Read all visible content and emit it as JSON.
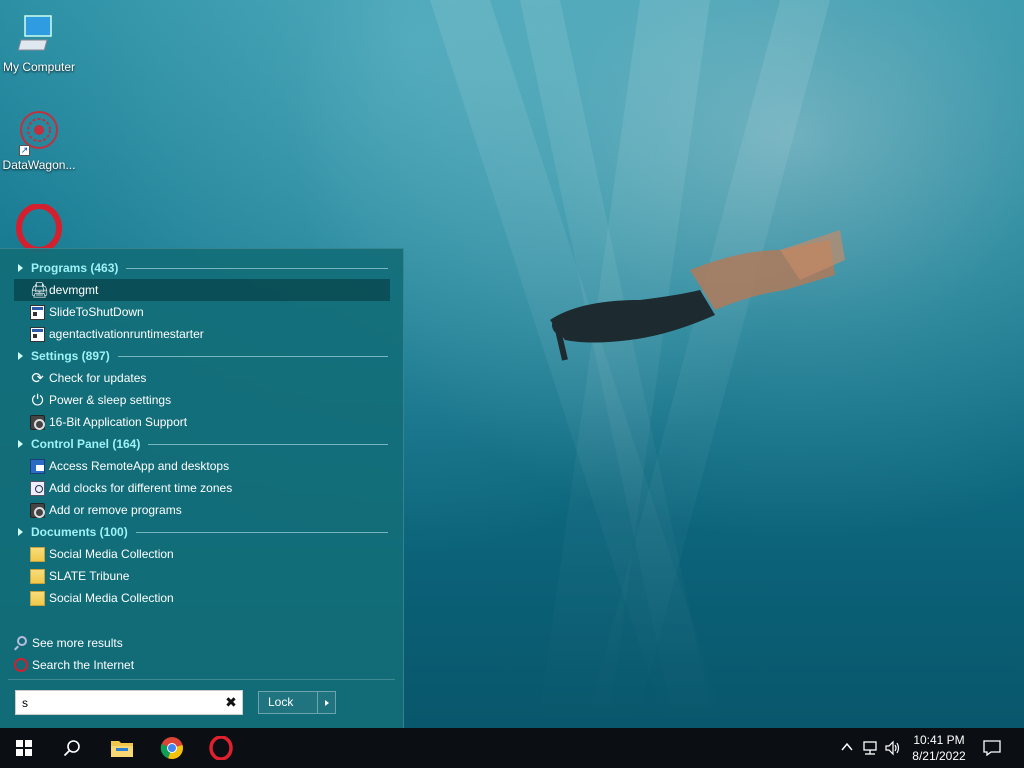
{
  "desktop": {
    "icons": [
      {
        "label": "My Computer",
        "icon": "computer-icon"
      },
      {
        "label": "DataWagon...",
        "icon": "datawagon-icon"
      },
      {
        "label": "",
        "icon": "opera-icon"
      }
    ]
  },
  "start_menu": {
    "groups": [
      {
        "title": "Programs (463)",
        "items": [
          {
            "label": "devmgmt",
            "icon": "device-manager-icon",
            "selected": true
          },
          {
            "label": "SlideToShutDown",
            "icon": "app-window-icon"
          },
          {
            "label": "agentactivationruntimestarter",
            "icon": "app-window-icon"
          }
        ]
      },
      {
        "title": "Settings (897)",
        "items": [
          {
            "label": "Check for updates",
            "icon": "refresh-icon"
          },
          {
            "label": "Power & sleep settings",
            "icon": "power-icon"
          },
          {
            "label": "16-Bit Application Support",
            "icon": "control-panel-icon"
          }
        ]
      },
      {
        "title": "Control Panel (164)",
        "items": [
          {
            "label": "Access RemoteApp and desktops",
            "icon": "remote-desktop-icon"
          },
          {
            "label": "Add clocks for different time zones",
            "icon": "clock-icon"
          },
          {
            "label": "Add or remove programs",
            "icon": "control-panel-icon"
          }
        ]
      },
      {
        "title": "Documents (100)",
        "items": [
          {
            "label": "Social Media Collection",
            "icon": "folder-icon"
          },
          {
            "label": "SLATE Tribune",
            "icon": "folder-icon"
          },
          {
            "label": "Social Media Collection",
            "icon": "folder-icon"
          }
        ]
      }
    ],
    "see_more": "See more results",
    "search_internet": "Search the Internet",
    "search_value": "s",
    "lock_label": "Lock"
  },
  "taskbar": {
    "time": "10:41 PM",
    "date": "8/21/2022",
    "pinned": [
      "file-explorer-icon",
      "chrome-icon",
      "opera-icon"
    ]
  }
}
